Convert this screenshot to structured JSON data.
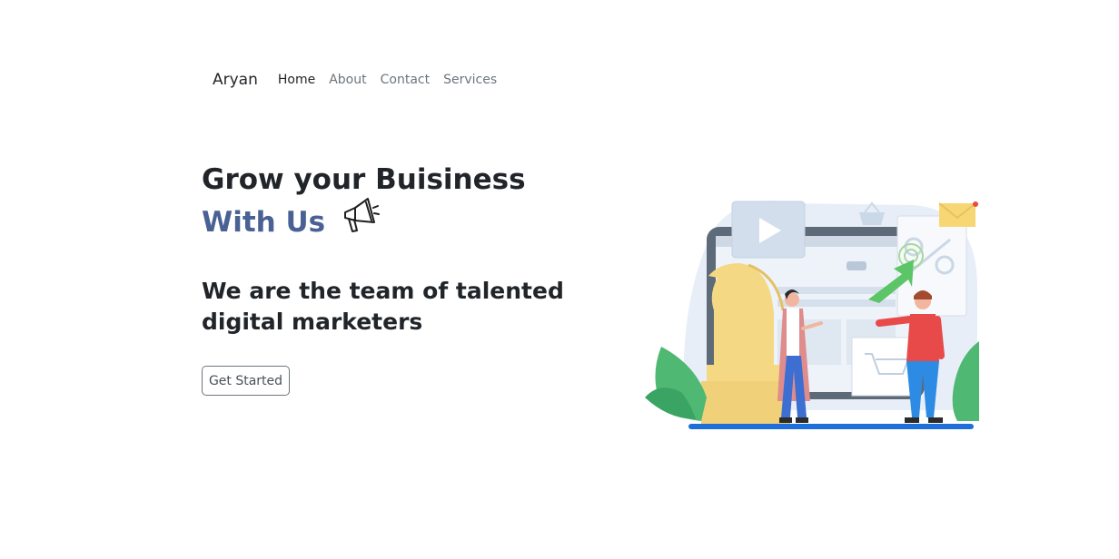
{
  "navbar": {
    "brand": "Aryan",
    "links": [
      {
        "label": "Home",
        "active": true
      },
      {
        "label": "About",
        "active": false
      },
      {
        "label": "Contact",
        "active": false
      },
      {
        "label": "Services",
        "active": false
      }
    ]
  },
  "hero": {
    "headline_line1": "Grow your Buisiness",
    "headline_line2": "With Us",
    "headline_icon": "megaphone-icon",
    "subheadline": "We are the team of talented digital marketers",
    "cta_label": "Get Started",
    "accent_color": "#4a6194"
  },
  "illustration": {
    "subject": "digital-marketing-team-illustration"
  }
}
